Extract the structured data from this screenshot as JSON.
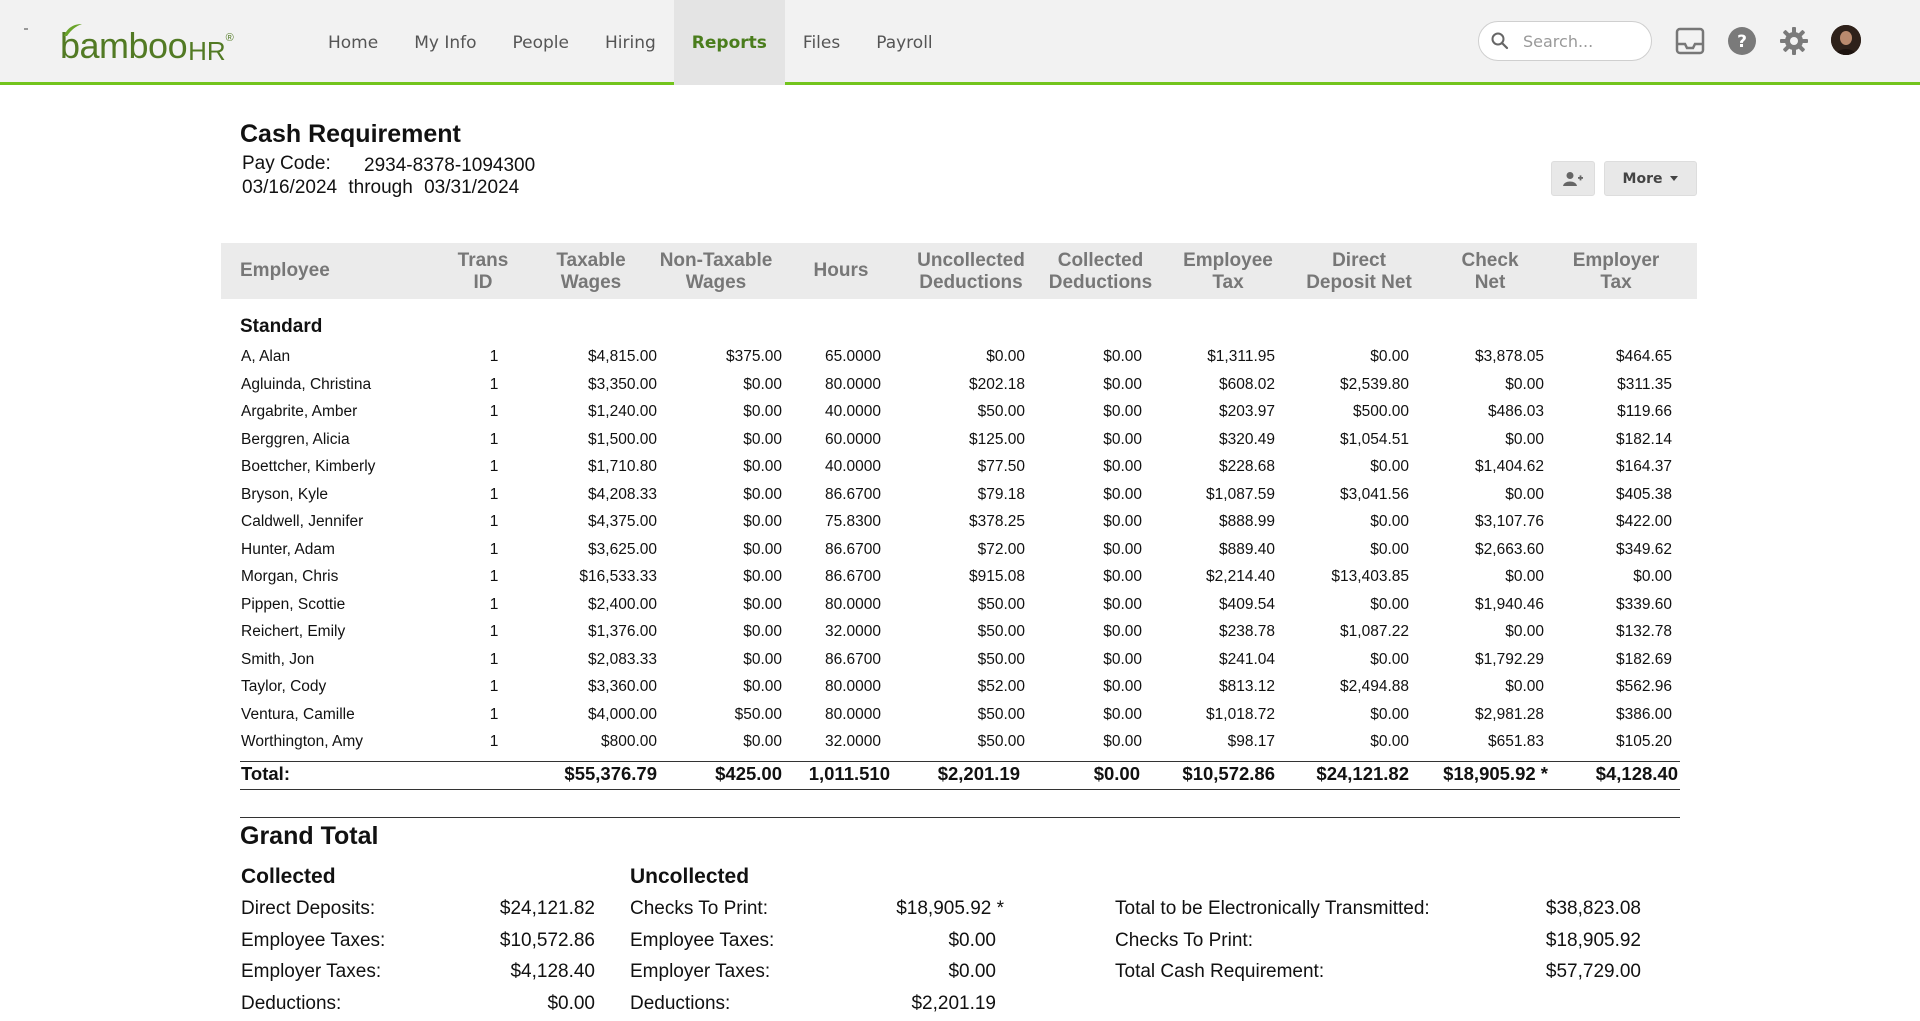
{
  "app": {
    "logo_text": "bamboo",
    "logo_hr": "HR",
    "logo_reg": "®",
    "nav": [
      "Home",
      "My Info",
      "People",
      "Hiring",
      "Reports",
      "Files",
      "Payroll"
    ],
    "active_nav": "Reports",
    "search_placeholder": "Search...",
    "accent": "#73c41d",
    "brand": "#527a24"
  },
  "report": {
    "title": "Cash Requirement",
    "pay_code_label": "Pay Code:",
    "pay_code": "2934-8378-1094300",
    "date_from": "03/16/2024",
    "date_through": "through",
    "date_to": "03/31/2024",
    "more_label": "More"
  },
  "table": {
    "headers": [
      [
        "Employee"
      ],
      [
        "Trans",
        "ID"
      ],
      [
        "Taxable",
        "Wages"
      ],
      [
        "Non-Taxable",
        "Wages"
      ],
      [
        "Hours"
      ],
      [
        "Uncollected",
        "Deductions"
      ],
      [
        "Collected",
        "Deductions"
      ],
      [
        "Employee",
        "Tax"
      ],
      [
        "Direct",
        "Deposit Net"
      ],
      [
        "Check",
        "Net"
      ],
      [
        "Employer",
        "Tax"
      ]
    ],
    "section": "Standard",
    "rows": [
      [
        "A, Alan",
        "1",
        "$4,815.00",
        "$375.00",
        "65.0000",
        "$0.00",
        "$0.00",
        "$1,311.95",
        "$0.00",
        "$3,878.05",
        "$464.65"
      ],
      [
        "Agluinda, Christina",
        "1",
        "$3,350.00",
        "$0.00",
        "80.0000",
        "$202.18",
        "$0.00",
        "$608.02",
        "$2,539.80",
        "$0.00",
        "$311.35"
      ],
      [
        "Argabrite, Amber",
        "1",
        "$1,240.00",
        "$0.00",
        "40.0000",
        "$50.00",
        "$0.00",
        "$203.97",
        "$500.00",
        "$486.03",
        "$119.66"
      ],
      [
        "Berggren, Alicia",
        "1",
        "$1,500.00",
        "$0.00",
        "60.0000",
        "$125.00",
        "$0.00",
        "$320.49",
        "$1,054.51",
        "$0.00",
        "$182.14"
      ],
      [
        "Boettcher, Kimberly",
        "1",
        "$1,710.80",
        "$0.00",
        "40.0000",
        "$77.50",
        "$0.00",
        "$228.68",
        "$0.00",
        "$1,404.62",
        "$164.37"
      ],
      [
        "Bryson, Kyle",
        "1",
        "$4,208.33",
        "$0.00",
        "86.6700",
        "$79.18",
        "$0.00",
        "$1,087.59",
        "$3,041.56",
        "$0.00",
        "$405.38"
      ],
      [
        "Caldwell, Jennifer",
        "1",
        "$4,375.00",
        "$0.00",
        "75.8300",
        "$378.25",
        "$0.00",
        "$888.99",
        "$0.00",
        "$3,107.76",
        "$422.00"
      ],
      [
        "Hunter, Adam",
        "1",
        "$3,625.00",
        "$0.00",
        "86.6700",
        "$72.00",
        "$0.00",
        "$889.40",
        "$0.00",
        "$2,663.60",
        "$349.62"
      ],
      [
        "Morgan, Chris",
        "1",
        "$16,533.33",
        "$0.00",
        "86.6700",
        "$915.08",
        "$0.00",
        "$2,214.40",
        "$13,403.85",
        "$0.00",
        "$0.00"
      ],
      [
        "Pippen, Scottie",
        "1",
        "$2,400.00",
        "$0.00",
        "80.0000",
        "$50.00",
        "$0.00",
        "$409.54",
        "$0.00",
        "$1,940.46",
        "$339.60"
      ],
      [
        "Reichert, Emily",
        "1",
        "$1,376.00",
        "$0.00",
        "32.0000",
        "$50.00",
        "$0.00",
        "$238.78",
        "$1,087.22",
        "$0.00",
        "$132.78"
      ],
      [
        "Smith, Jon",
        "1",
        "$2,083.33",
        "$0.00",
        "86.6700",
        "$50.00",
        "$0.00",
        "$241.04",
        "$0.00",
        "$1,792.29",
        "$182.69"
      ],
      [
        "Taylor, Cody",
        "1",
        "$3,360.00",
        "$0.00",
        "80.0000",
        "$52.00",
        "$0.00",
        "$813.12",
        "$2,494.88",
        "$0.00",
        "$562.96"
      ],
      [
        "Ventura, Camille",
        "1",
        "$4,000.00",
        "$50.00",
        "80.0000",
        "$50.00",
        "$0.00",
        "$1,018.72",
        "$0.00",
        "$2,981.28",
        "$386.00"
      ],
      [
        "Worthington, Amy",
        "1",
        "$800.00",
        "$0.00",
        "32.0000",
        "$50.00",
        "$0.00",
        "$98.17",
        "$0.00",
        "$651.83",
        "$105.20"
      ]
    ],
    "total": [
      "Total:",
      "",
      "$55,376.79",
      "$425.00",
      "1,011.510",
      "$2,201.19",
      "$0.00",
      "$10,572.86",
      "$24,121.82",
      "$18,905.92 *",
      "$4,128.40"
    ]
  },
  "grand_total": {
    "title": "Grand Total",
    "collected": {
      "heading": "Collected",
      "rows": [
        [
          "Direct Deposits:",
          "$24,121.82"
        ],
        [
          "Employee Taxes:",
          "$10,572.86"
        ],
        [
          "Employer Taxes:",
          "$4,128.40"
        ],
        [
          "Deductions:",
          "$0.00"
        ]
      ]
    },
    "uncollected": {
      "heading": "Uncollected",
      "rows": [
        [
          "Checks To Print:",
          "$18,905.92 *"
        ],
        [
          "Employee Taxes:",
          "$0.00"
        ],
        [
          "Employer Taxes:",
          "$0.00"
        ],
        [
          "Deductions:",
          "$2,201.19"
        ]
      ]
    },
    "summary": {
      "rows": [
        [
          "Total to be Electronically Transmitted:",
          "$38,823.08"
        ],
        [
          "Checks To Print:",
          "$18,905.92"
        ],
        [
          "Total Cash Requirement:",
          "$57,729.00"
        ]
      ]
    }
  }
}
